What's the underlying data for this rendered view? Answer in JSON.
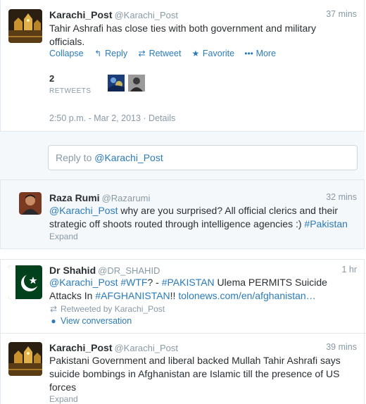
{
  "tweets": [
    {
      "name": "Karachi_Post",
      "handle": "@Karachi_Post",
      "time": "37 mins",
      "text": "Tahir Ashrafi has close ties with both government and military officials.",
      "actions": {
        "collapse": "Collapse",
        "reply": "Reply",
        "retweet": "Retweet",
        "favorite": "Favorite",
        "more": "More"
      },
      "retweets_count": "2",
      "retweets_label": "RETWEETS",
      "datetime": "2:50 p.m. - Mar 2, 2013",
      "details": "Details"
    }
  ],
  "reply": {
    "prefix": "Reply to",
    "mention": "@Karachi_Post"
  },
  "reply_tweet": {
    "name": "Raza Rumi",
    "handle": "@Razarumi",
    "time": "32 mins",
    "mention": "@Karachi_Post",
    "text": " why are you surprised? All official clerics and their strategic off shoots routed through intelligence agencies :) ",
    "hashtag": "#Pakistan",
    "expand": "Expand"
  },
  "shahid_tweet": {
    "name": "Dr Shahid",
    "handle": "@DR_SHAHID",
    "time": "1 hr",
    "mention": "@Karachi_Post",
    "tag1": "#WTF",
    "sep": "? - ",
    "tag2": "#PAKISTAN",
    "text1": " Ulema PERMITS Suicide Attacks In ",
    "tag3": "#AFGHANISTAN",
    "text2": "!! ",
    "link": "tolonews.com/en/afghanistan…",
    "retweeted_by": "Retweeted by Karachi_Post",
    "view_conversation": "View conversation"
  },
  "last_tweet": {
    "name": "Karachi_Post",
    "handle": "@Karachi_Post",
    "time": "39 mins",
    "text": "Pakistani Government and liberal backed Mullah Tahir Ashrafi says suicide bombings in Afghanistan are Islamic till the presence of US forces",
    "expand": "Expand"
  },
  "colors": {
    "link": "#2b7bb9",
    "muted": "#8899a6",
    "pakistan_green": "#01411c"
  }
}
